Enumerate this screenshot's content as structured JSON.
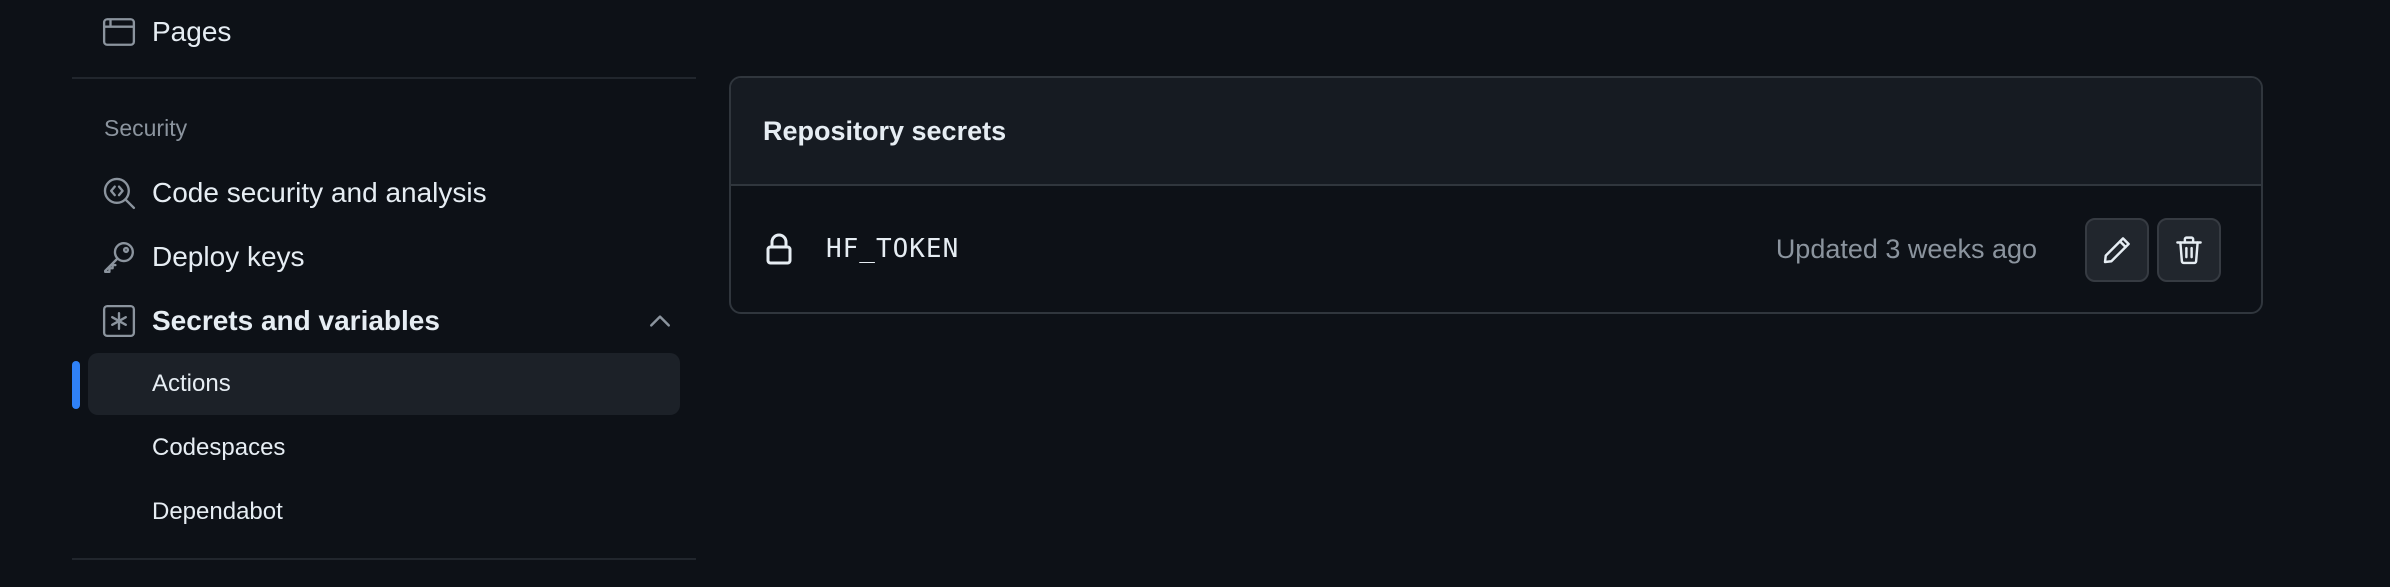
{
  "sidebar": {
    "pages": {
      "label": "Pages",
      "icon": "browser-icon"
    },
    "security_heading": "Security",
    "code_security": {
      "label": "Code security and analysis",
      "icon": "codescan-icon"
    },
    "deploy_keys": {
      "label": "Deploy keys",
      "icon": "key-icon"
    },
    "secrets": {
      "label": "Secrets and variables",
      "icon": "asterisk-icon",
      "expanded": true,
      "items": [
        {
          "label": "Actions",
          "active": true
        },
        {
          "label": "Codespaces",
          "active": false
        },
        {
          "label": "Dependabot",
          "active": false
        }
      ]
    }
  },
  "main": {
    "panel_title": "Repository secrets",
    "secrets": [
      {
        "name": "HF_TOKEN",
        "updated": "Updated 3 weeks ago"
      }
    ],
    "edit_icon": "pencil-icon",
    "delete_icon": "trash-icon"
  },
  "colors": {
    "background": "#0d1117",
    "accent": "#2f81f7",
    "muted_text": "#8b949e",
    "border": "#30363d"
  }
}
